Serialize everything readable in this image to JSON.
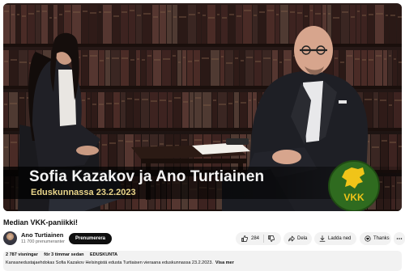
{
  "video": {
    "lower_third": {
      "names": "Sofia Kazakov ja Ano Turtiainen",
      "subtitle": "Eduskunnassa 23.2.2023"
    },
    "logo": {
      "text": "VKK",
      "icon": "lion-crest-icon",
      "color": "#2f6b1f",
      "accent": "#f0c419"
    }
  },
  "title": "Median VKK-paniikki!",
  "channel": {
    "name": "Ano Turtiainen",
    "subscribers": "11 700 prenumeranter",
    "subscribe_label": "Prenumerera",
    "avatar_icon": "avatar-portrait"
  },
  "actions": {
    "like_count": "284",
    "like_icon": "thumbs-up-icon",
    "dislike_icon": "thumbs-down-icon",
    "share_label": "Dela",
    "share_icon": "share-arrow-icon",
    "download_label": "Ladda ned",
    "download_icon": "download-icon",
    "thanks_label": "Thanks",
    "thanks_icon": "thanks-heart-icon",
    "more_icon": "more-horizontal-icon"
  },
  "description": {
    "views": "2 787 visningar",
    "age": "för 3 timmar sedan",
    "tag": "EDUSKUNTA",
    "text": "Kansanedustajaehdokas Sofia Kazakov Helsingistä edusta Turtiaisen vieraana eduskunnassa 23.2.2023.",
    "more_label": "Visa mer"
  },
  "colors": {
    "subscribe_bg": "#0f0f0f",
    "pill_bg": "#f2f2f2",
    "lower_third_sub": "#e9d58a",
    "logo_green": "#2f6b1f"
  }
}
